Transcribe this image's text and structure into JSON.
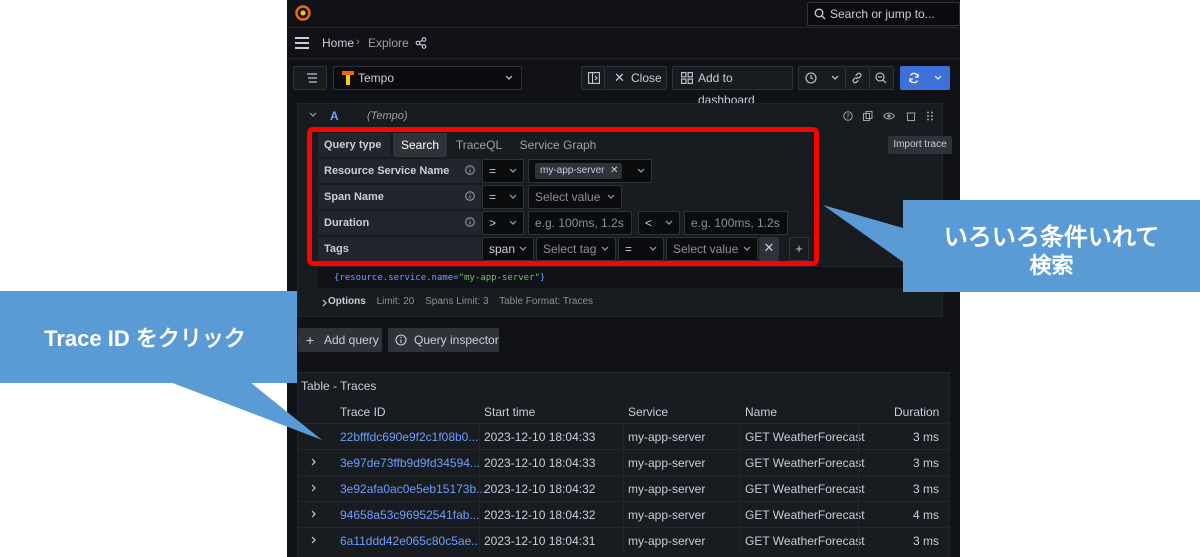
{
  "topbar": {
    "search_placeholder": "Search or jump to..."
  },
  "breadcrumb": {
    "home": "Home",
    "separator": "›",
    "current": "Explore"
  },
  "toolbar": {
    "datasource": "Tempo",
    "close_label": "Close",
    "add_to_dashboard_label": "Add to dashboard"
  },
  "query": {
    "ref_id": "A",
    "datasource": "(Tempo)",
    "query_type_label": "Query type",
    "tabs": [
      "Search",
      "TraceQL",
      "Service Graph"
    ],
    "active_tab": "Search",
    "import_trace_label": "Import trace",
    "fields": {
      "resource_service_name": {
        "label": "Resource Service Name",
        "operator": "=",
        "value": "my-app-server"
      },
      "span_name": {
        "label": "Span Name",
        "operator": "=",
        "value_placeholder": "Select value"
      },
      "duration": {
        "label": "Duration",
        "min_operator": ">",
        "min_placeholder": "e.g. 100ms, 1.2s",
        "max_operator": "<",
        "max_placeholder": "e.g. 100ms, 1.2s"
      },
      "tags": {
        "label": "Tags",
        "scope": "span",
        "tag_placeholder": "Select tag",
        "operator": "=",
        "value_placeholder": "Select value"
      }
    },
    "traceql_open": "{",
    "traceql_key": "resource.service.name=",
    "traceql_value": "\"my-app-server\"",
    "traceql_close": "}",
    "options": {
      "title": "Options",
      "limit": "Limit: 20",
      "spans_limit": "Spans Limit: 3",
      "table_format": "Table Format: Traces"
    }
  },
  "actions": {
    "add_query": "Add query",
    "query_inspector": "Query inspector"
  },
  "table": {
    "title": "Table - Traces",
    "columns": [
      "Trace ID",
      "Start time",
      "Service",
      "Name",
      "Duration"
    ],
    "rows": [
      {
        "trace_id": "22bfffdc690e9f2c1f08b0...",
        "start_time": "2023-12-10 18:04:33",
        "service": "my-app-server",
        "name": "GET WeatherForecast",
        "duration": "3 ms"
      },
      {
        "trace_id": "3e97de73ffb9d9fd34594...",
        "start_time": "2023-12-10 18:04:33",
        "service": "my-app-server",
        "name": "GET WeatherForecast",
        "duration": "3 ms"
      },
      {
        "trace_id": "3e92afa0ac0e5eb15173b...",
        "start_time": "2023-12-10 18:04:32",
        "service": "my-app-server",
        "name": "GET WeatherForecast",
        "duration": "3 ms"
      },
      {
        "trace_id": "94658a53c96952541fab...",
        "start_time": "2023-12-10 18:04:32",
        "service": "my-app-server",
        "name": "GET WeatherForecast",
        "duration": "4 ms"
      },
      {
        "trace_id": "6a11ddd42e065c80c5ae...",
        "start_time": "2023-12-10 18:04:31",
        "service": "my-app-server",
        "name": "GET WeatherForecast",
        "duration": "3 ms"
      }
    ]
  },
  "annotations": {
    "right_line1": "いろいろ条件いれて",
    "right_line2": "検索",
    "left": "Trace ID をクリック"
  },
  "colors": {
    "accent": "#6e9fff",
    "run_button": "#3d71d9",
    "annotation_box": "#ff0000",
    "callout": "#5b9bd5"
  }
}
